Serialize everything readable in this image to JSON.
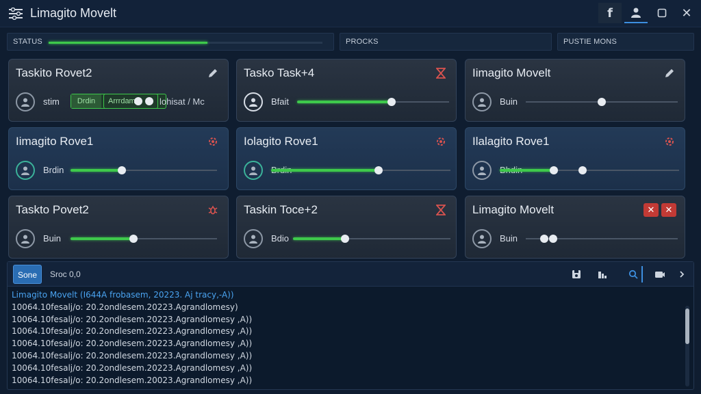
{
  "app": {
    "title": "Limagito Movelt"
  },
  "window_buttons": {
    "facebook": "f",
    "close": "✕"
  },
  "status_bars": [
    {
      "label": "STATUS",
      "progress": 0.58
    },
    {
      "label": "PROCKS"
    },
    {
      "label": "PUSTIE MONS"
    }
  ],
  "cards": [
    {
      "title": "Taskito Rovet2",
      "icon": "edit-icon",
      "slider_label": "stim",
      "seg_a": "Drdin",
      "seg_b": "Arrrdam",
      "seg_text": "lohisat / Mc"
    },
    {
      "title": "Tasko Task+4",
      "icon": "hourglass-icon",
      "slider_label": "Bfait",
      "value": 0.62
    },
    {
      "title": "Iimagito Movelt",
      "icon": "edit-icon",
      "slider_label": "Buin",
      "value": 0.5
    },
    {
      "title": "Iimagito Rove1",
      "icon": "gear-icon",
      "slider_label": "Brdin",
      "value": 0.35
    },
    {
      "title": "Iolagito Rove1",
      "icon": "gear-icon",
      "slider_label": "Brdin",
      "value": 0.6
    },
    {
      "title": "Ilalagito Rove1",
      "icon": "gear-icon",
      "slider_label": "Bhdin",
      "value": 0.3
    },
    {
      "title": "Taskto Povet2",
      "icon": "bug-icon",
      "slider_label": "Buin",
      "value": 0.43
    },
    {
      "title": "Taskin Toce+2",
      "icon": "hourglass-icon",
      "slider_label": "Bdio",
      "value": 0.33
    },
    {
      "title": "Limagito Movelt",
      "icon": "close-icon",
      "slider_label": "Buin",
      "value": 0.12,
      "badges": [
        "✕",
        "✕"
      ]
    }
  ],
  "log": {
    "tab_active": "Sone",
    "tab_other": "Sroc 0,0",
    "lines": [
      "Limagito Movelt (I644A frobasem, 20223. Aj tracy,-A))",
      "10064.10fesalj/o: 20.2ondlesem.20223.Agrandlomesy)",
      "10064.10fesalj/o: 20.2ondlesem.20223.Agrandlomesy ,A))",
      "10064.10fesalj/o: 20.2ondlesem.20223.Agrandlomesy ,A))",
      "10064.10fesalj/o: 20.2ondlesem.20223.Agrandlomesy ,A))",
      "10064.10fesalj/o: 20.2ondlesem.20223.Agrandlomesy ,A))",
      "10064.10fesalj/o: 20.2ondlesem.20223.Agrandlomesy ,A))",
      "10064.10fesalj/o: 20.2ondlesem.20023.Agrandlomesy ,A))"
    ]
  }
}
